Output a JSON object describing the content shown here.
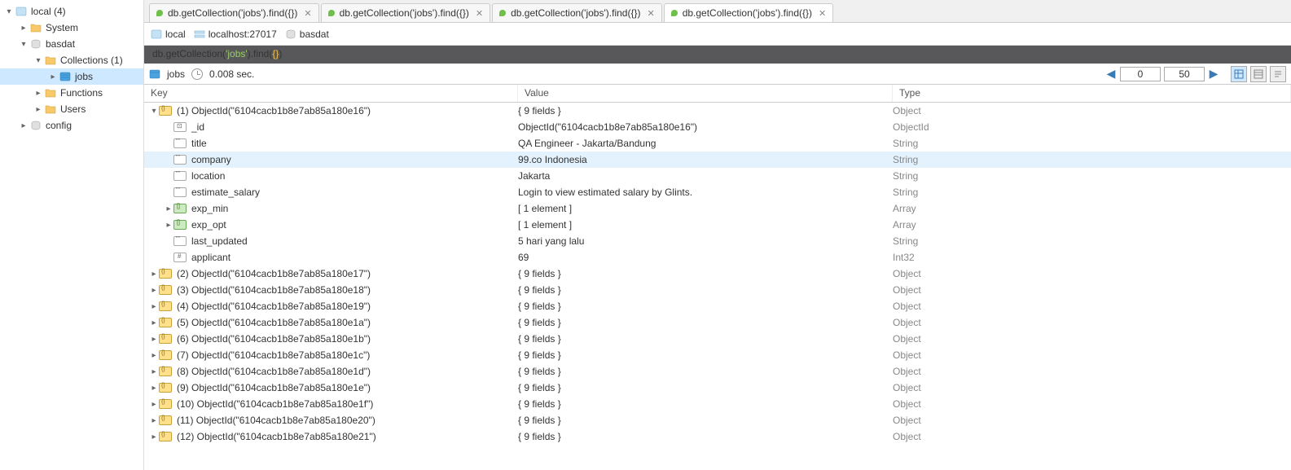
{
  "sidebar": {
    "root": "local (4)",
    "items": [
      {
        "label": "System",
        "depth": 1,
        "icon": "folder"
      },
      {
        "label": "basdat",
        "depth": 1,
        "icon": "db",
        "expanded": true
      },
      {
        "label": "Collections (1)",
        "depth": 2,
        "icon": "folder",
        "expanded": true
      },
      {
        "label": "jobs",
        "depth": 3,
        "icon": "collection",
        "selected": true
      },
      {
        "label": "Functions",
        "depth": 2,
        "icon": "folder"
      },
      {
        "label": "Users",
        "depth": 2,
        "icon": "folder"
      },
      {
        "label": "config",
        "depth": 1,
        "icon": "db"
      }
    ]
  },
  "tabs": [
    {
      "label": "db.getCollection('jobs').find({})",
      "active": false
    },
    {
      "label": "db.getCollection('jobs').find({})",
      "active": false
    },
    {
      "label": "db.getCollection('jobs').find({})",
      "active": false
    },
    {
      "label": "db.getCollection('jobs').find({})",
      "active": true
    }
  ],
  "breadcrumb": {
    "host": "local",
    "server": "localhost:27017",
    "database": "basdat"
  },
  "query": {
    "prefix": "db.getCollection(",
    "string": "'jobs'",
    "mid": ").find(",
    "braces": "{}",
    "suffix": ")"
  },
  "status": {
    "collection": "jobs",
    "time": "0.008 sec."
  },
  "pager": {
    "offset": "0",
    "limit": "50"
  },
  "columns": {
    "key": "Key",
    "value": "Value",
    "type": "Type"
  },
  "expanded_doc": {
    "indexLabel": "(1) ObjectId(\"6104cacb1b8e7ab85a180e16\")",
    "summary": "{ 9 fields }",
    "type": "Object",
    "fields": [
      {
        "key": "_id",
        "value": "ObjectId(\"6104cacb1b8e7ab85a180e16\")",
        "type": "ObjectId",
        "icon": "id"
      },
      {
        "key": "title",
        "value": "QA Engineer - Jakarta/Bandung",
        "type": "String",
        "icon": "str"
      },
      {
        "key": "company",
        "value": "99.co Indonesia",
        "type": "String",
        "icon": "str",
        "highlight": true
      },
      {
        "key": "location",
        "value": "Jakarta",
        "type": "String",
        "icon": "str"
      },
      {
        "key": "estimate_salary",
        "value": "Login to view estimated salary by Glints.",
        "type": "String",
        "icon": "str"
      },
      {
        "key": "exp_min",
        "value": "[ 1 element ]",
        "type": "Array",
        "icon": "arr",
        "expandable": true
      },
      {
        "key": "exp_opt",
        "value": "[ 1 element ]",
        "type": "Array",
        "icon": "arr",
        "expandable": true
      },
      {
        "key": "last_updated",
        "value": "5 hari yang lalu",
        "type": "String",
        "icon": "str"
      },
      {
        "key": "applicant",
        "value": "69",
        "type": "Int32",
        "icon": "num"
      }
    ]
  },
  "collapsed_docs": [
    {
      "label": "(2) ObjectId(\"6104cacb1b8e7ab85a180e17\")",
      "value": "{ 9 fields }",
      "type": "Object"
    },
    {
      "label": "(3) ObjectId(\"6104cacb1b8e7ab85a180e18\")",
      "value": "{ 9 fields }",
      "type": "Object"
    },
    {
      "label": "(4) ObjectId(\"6104cacb1b8e7ab85a180e19\")",
      "value": "{ 9 fields }",
      "type": "Object"
    },
    {
      "label": "(5) ObjectId(\"6104cacb1b8e7ab85a180e1a\")",
      "value": "{ 9 fields }",
      "type": "Object"
    },
    {
      "label": "(6) ObjectId(\"6104cacb1b8e7ab85a180e1b\")",
      "value": "{ 9 fields }",
      "type": "Object"
    },
    {
      "label": "(7) ObjectId(\"6104cacb1b8e7ab85a180e1c\")",
      "value": "{ 9 fields }",
      "type": "Object"
    },
    {
      "label": "(8) ObjectId(\"6104cacb1b8e7ab85a180e1d\")",
      "value": "{ 9 fields }",
      "type": "Object"
    },
    {
      "label": "(9) ObjectId(\"6104cacb1b8e7ab85a180e1e\")",
      "value": "{ 9 fields }",
      "type": "Object"
    },
    {
      "label": "(10) ObjectId(\"6104cacb1b8e7ab85a180e1f\")",
      "value": "{ 9 fields }",
      "type": "Object"
    },
    {
      "label": "(11) ObjectId(\"6104cacb1b8e7ab85a180e20\")",
      "value": "{ 9 fields }",
      "type": "Object"
    },
    {
      "label": "(12) ObjectId(\"6104cacb1b8e7ab85a180e21\")",
      "value": "{ 9 fields }",
      "type": "Object"
    }
  ]
}
